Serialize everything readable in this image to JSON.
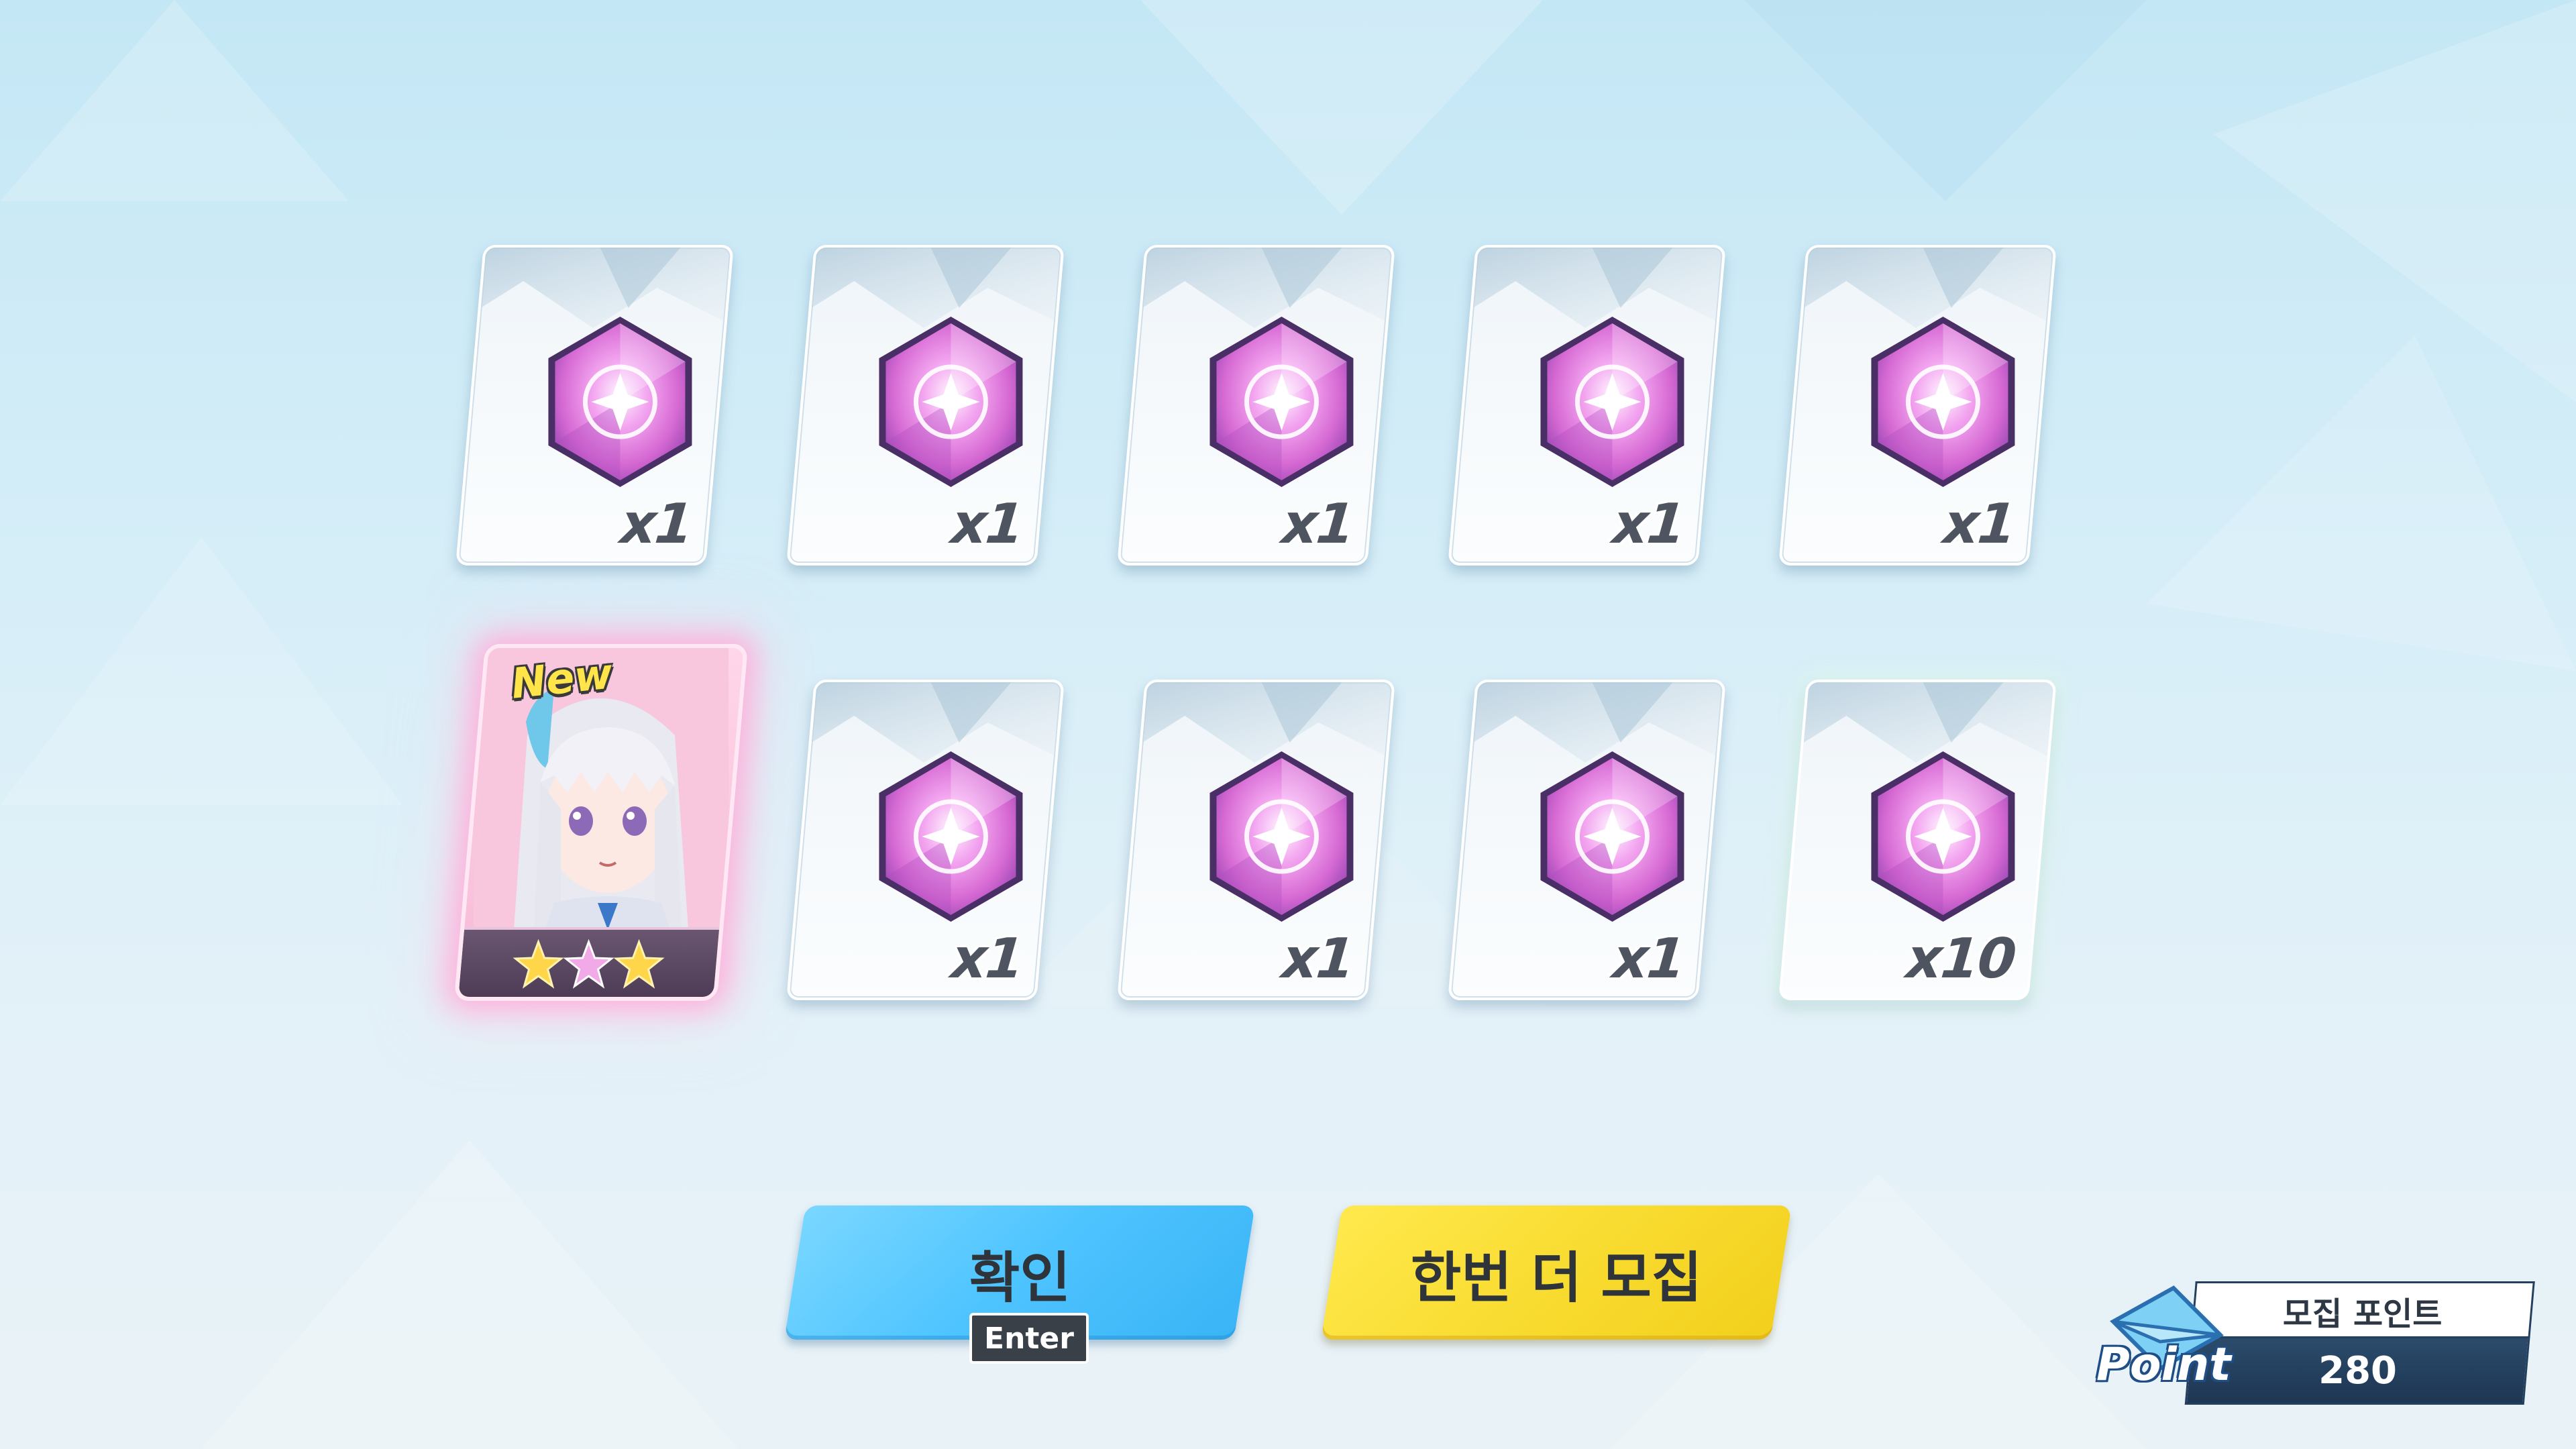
{
  "cards": [
    {
      "qty": "x1",
      "item": "recruit-gem"
    },
    {
      "qty": "x1",
      "item": "recruit-gem"
    },
    {
      "qty": "x1",
      "item": "recruit-gem"
    },
    {
      "qty": "x1",
      "item": "recruit-gem"
    },
    {
      "qty": "x1",
      "item": "recruit-gem"
    },
    {
      "qty": "x1",
      "item": "recruit-gem"
    },
    {
      "qty": "x1",
      "item": "recruit-gem"
    },
    {
      "qty": "x1",
      "item": "recruit-gem"
    },
    {
      "qty": "x10",
      "item": "recruit-gem"
    }
  ],
  "character_card": {
    "badge": "New",
    "stars": 3
  },
  "buttons": {
    "confirm_label": "확인",
    "confirm_hotkey": "Enter",
    "again_label": "한번 더 모집"
  },
  "points": {
    "title": "모집 포인트",
    "value": "280",
    "icon_word": "Point"
  },
  "colors": {
    "confirm": "#4ec4ff",
    "again": "#f9dc31",
    "gem": "#e27ad9",
    "points_panel": "#23415f"
  }
}
